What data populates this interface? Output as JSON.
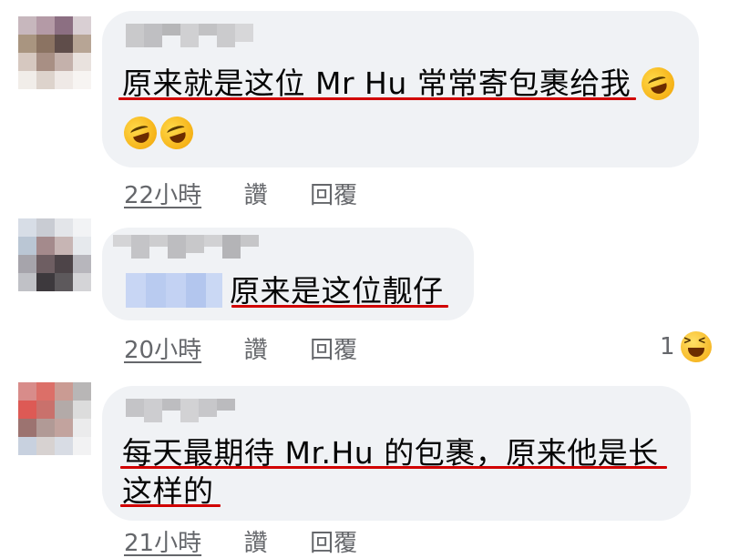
{
  "comments": [
    {
      "text_line1": "原来就是这位 Mr Hu 常常寄包裹给我",
      "time": "22小時",
      "like": "讚",
      "reply": "回覆",
      "reaction_count": ""
    },
    {
      "text_line1": "原来是这位靓仔",
      "time": "20小時",
      "like": "讚",
      "reply": "回覆",
      "reaction_count": "1"
    },
    {
      "text_line1": "每天最期待 Mr.Hu 的包裹，原来他是长",
      "text_line2": "这样的",
      "time": "21小時",
      "like": "讚",
      "reply": "回覆",
      "reaction_count": ""
    }
  ],
  "icons": {
    "rofl_emoji": "rolling-on-floor-laughing-icon",
    "haha_reaction": "haha-reaction-icon"
  },
  "colors": {
    "bubble": "#f0f2f5",
    "meta_text": "#65676b",
    "underline_annotation": "#d10000"
  }
}
